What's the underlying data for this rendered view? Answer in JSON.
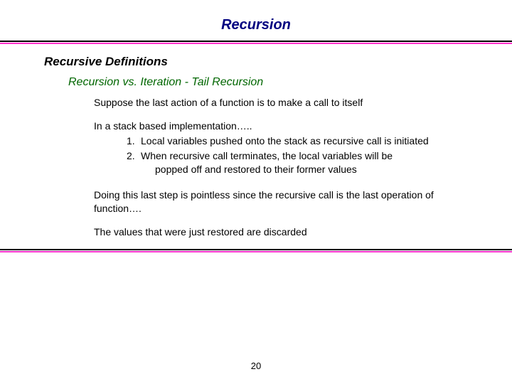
{
  "title": "Recursion",
  "heading2": "Recursive Definitions",
  "heading3": "Recursion vs. Iteration - Tail Recursion",
  "p1": "Suppose the last action of a function is to make a call to itself",
  "p2_lead": "In a stack based implementation…..",
  "list": [
    {
      "num": "1.",
      "text": "Local variables pushed onto the stack as recursive call is initiated"
    },
    {
      "num": "2.",
      "text": " When recursive call terminates, the local variables will be",
      "cont": "popped off and restored to their former values"
    }
  ],
  "p3": "Doing this last step is pointless since the recursive call is the last operation of function….",
  "p4": "The values that were just restored are discarded",
  "page": "20"
}
